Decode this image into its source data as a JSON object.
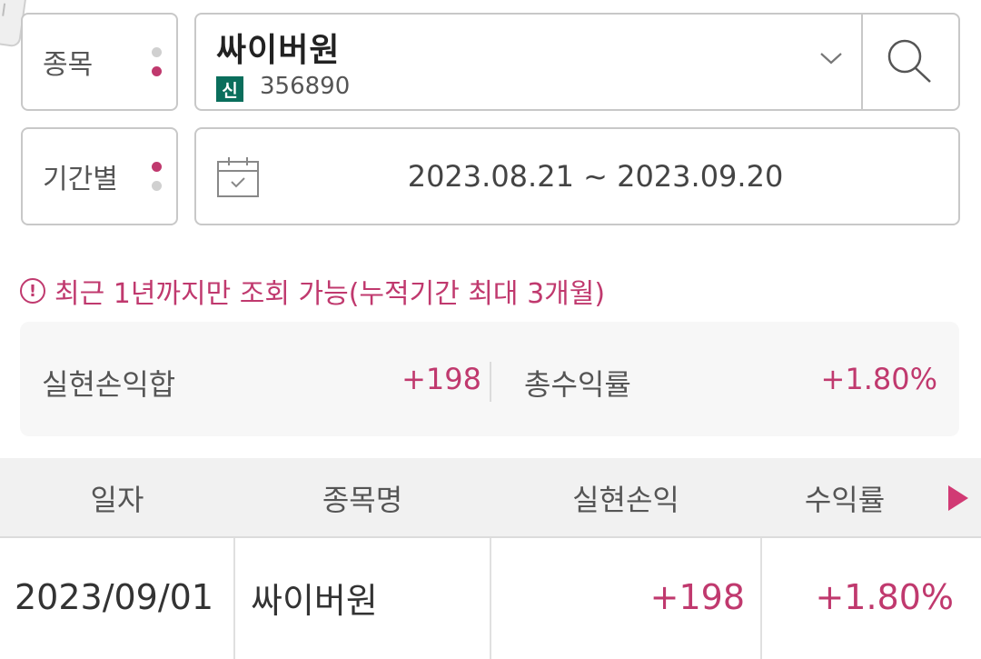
{
  "stock_field": {
    "label": "종목",
    "name": "싸이버원",
    "badge": "신",
    "code": "356890"
  },
  "period_field": {
    "label": "기간별",
    "date_range": "2023.08.21 ~ 2023.09.20"
  },
  "notice": {
    "icon": "!",
    "text": "최근 1년까지만 조회 가능(누적기간 최대 3개월)"
  },
  "summary": {
    "realized_pl_label": "실현손익합",
    "realized_pl_value": "+198",
    "total_return_label": "총수익률",
    "total_return_value": "+1.80%"
  },
  "table": {
    "headers": [
      "일자",
      "종목명",
      "실현손익",
      "수익률"
    ],
    "rows": [
      {
        "date": "2023/09/01",
        "name": "싸이버원",
        "realized_pl": "+198",
        "return_rate": "+1.80%"
      }
    ]
  },
  "colors": {
    "accent": "#c0396e",
    "badge": "#0a6e5c"
  }
}
